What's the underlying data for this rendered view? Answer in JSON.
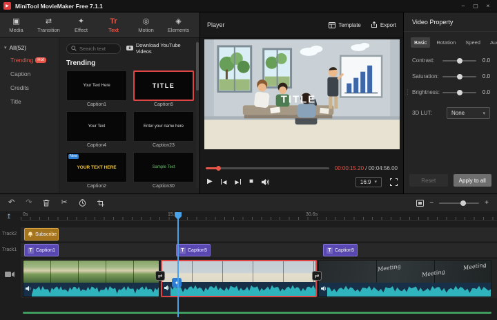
{
  "titlebar": {
    "title": "MiniTool MovieMaker Free 7.1.1"
  },
  "tabbar": {
    "tabs": [
      {
        "label": "Media"
      },
      {
        "label": "Transition"
      },
      {
        "label": "Effect"
      },
      {
        "label": "Text",
        "icon_text": "Tr",
        "active": true
      },
      {
        "label": "Motion"
      },
      {
        "label": "Elements"
      }
    ]
  },
  "sidebar": {
    "filter_label": "All(52)",
    "items": [
      {
        "label": "Trending",
        "badge": "Hot",
        "active": true
      },
      {
        "label": "Caption"
      },
      {
        "label": "Credits"
      },
      {
        "label": "Title"
      }
    ]
  },
  "library": {
    "search_placeholder": "Search text",
    "download_label": "Download YouTube Videos",
    "section_title": "Trending",
    "templates": [
      {
        "name": "Caption1",
        "sample": "Your Text Here"
      },
      {
        "name": "Caption5",
        "sample": "TITLE",
        "selected": true
      },
      {
        "name": "Caption4",
        "sample": "Your Text"
      },
      {
        "name": "Caption23",
        "sample": "Enter your name here"
      },
      {
        "name": "Caption2",
        "sample": "YOUR TEXT HERE",
        "badge": "New"
      },
      {
        "name": "Caption30",
        "sample": "Sample Text"
      }
    ]
  },
  "player": {
    "title": "Player",
    "template_button": "Template",
    "export_button": "Export",
    "preview_title": "TITLE",
    "current_time": "00:00:15.20",
    "separator": " / ",
    "total_time": "00:04:56.00",
    "aspect_ratio": "16:9"
  },
  "property": {
    "title": "Video Property",
    "tabs": [
      {
        "label": "Basic",
        "active": true
      },
      {
        "label": "Rotation"
      },
      {
        "label": "Speed"
      },
      {
        "label": "Audio"
      }
    ],
    "rows": [
      {
        "label": "Contrast:",
        "value": "0.0"
      },
      {
        "label": "Saturation:",
        "value": "0.0"
      },
      {
        "label": "Brightness:",
        "value": "0.0"
      }
    ],
    "lut_label": "3D LUT:",
    "lut_value": "None",
    "reset_label": "Reset",
    "apply_label": "Apply to all"
  },
  "timeline": {
    "ruler_labels": [
      "0s",
      "15.6s",
      "30.6s"
    ],
    "track2_label": "Track2",
    "track1_label": "Track1",
    "clips": {
      "subscribe_label": "Subscribe",
      "caption1_label": "Caption1",
      "caption5a_label": "Caption5",
      "caption5b_label": "Caption5",
      "chalk_words": [
        "Meeting",
        "Meeting",
        "Meeting"
      ]
    }
  }
}
